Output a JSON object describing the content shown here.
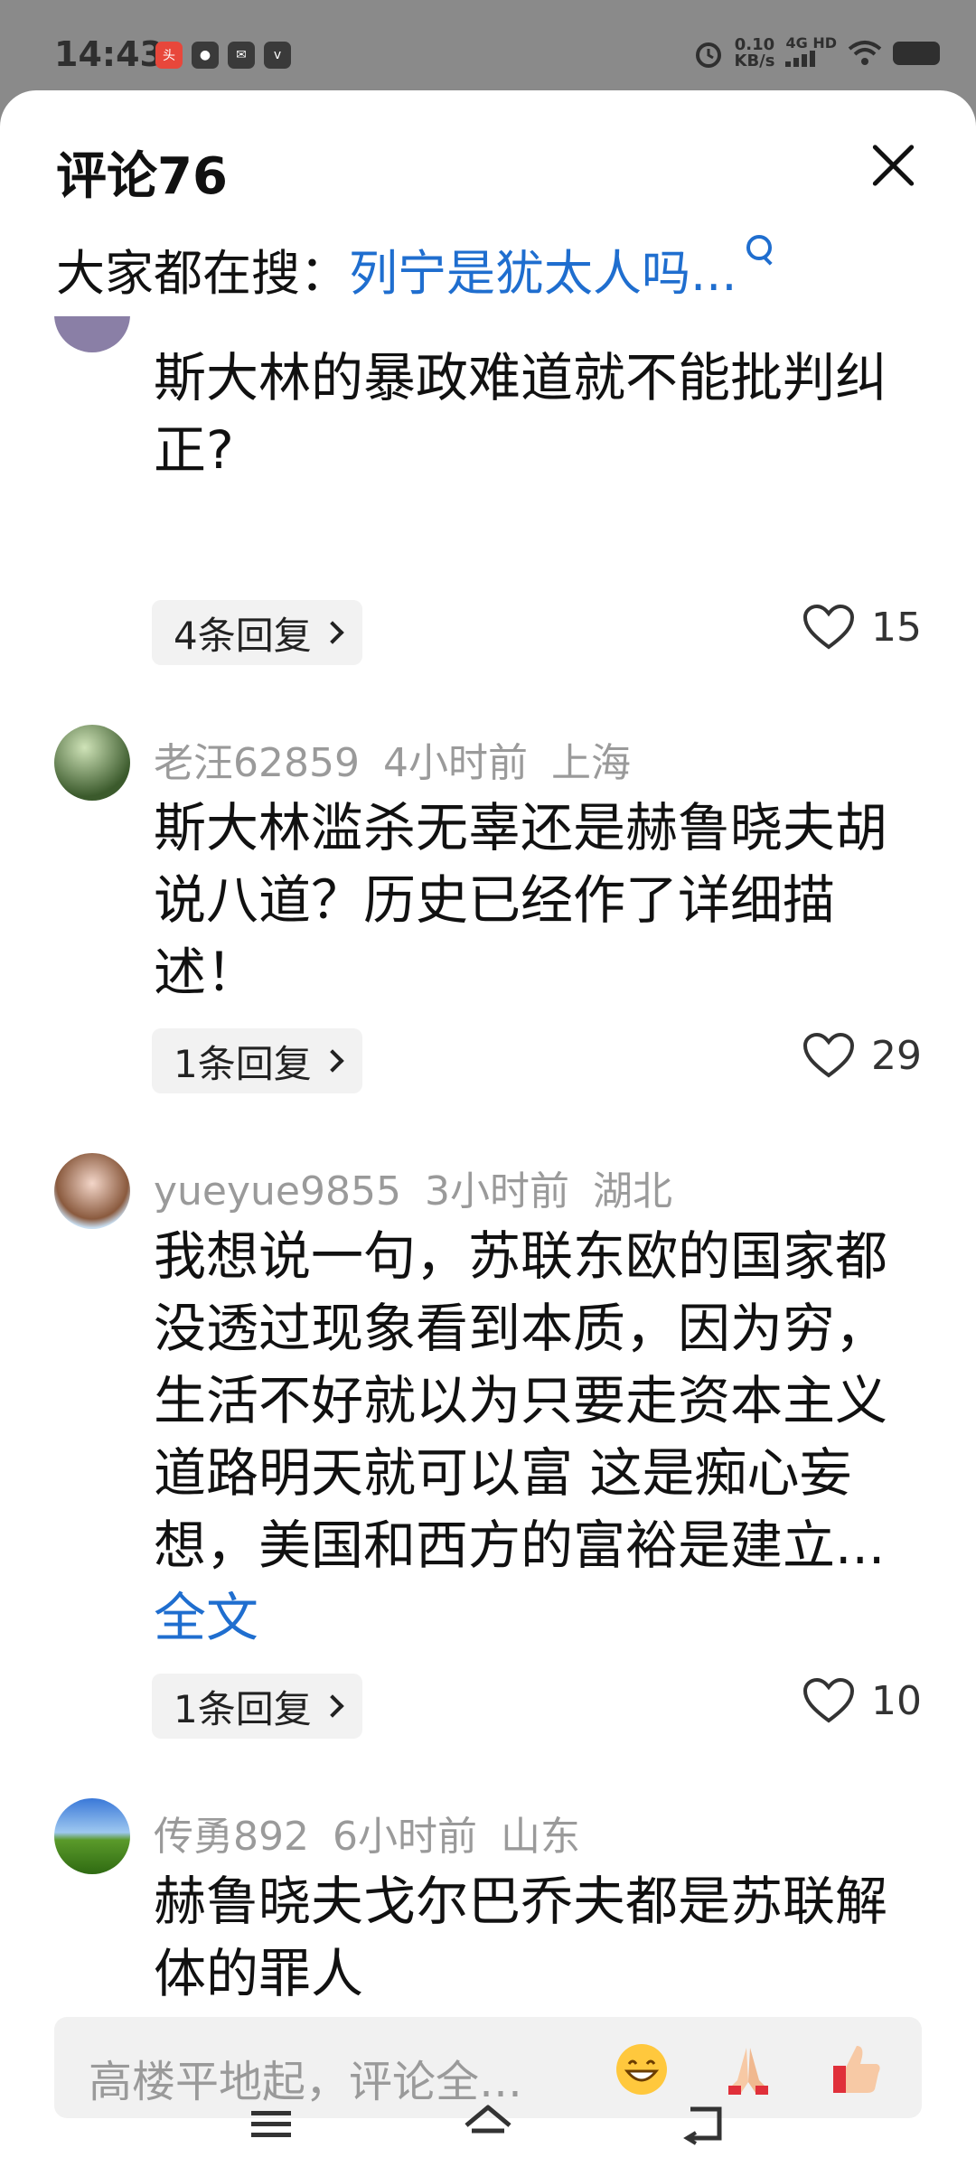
{
  "status": {
    "time": "14:43",
    "app_icons": [
      "头条",
      "wechat",
      "mail",
      "vivo"
    ],
    "net_speed_value": "0.10",
    "net_speed_unit": "KB/s",
    "net_type": "4G HD"
  },
  "sheet": {
    "title": "评论76",
    "trending_prefix": "大家都在搜：",
    "trending_link": "列宁是犹太人吗..."
  },
  "comments": [
    {
      "user": "",
      "time": "",
      "location": "",
      "text": "斯大林的暴政难道就不能批判纠正?",
      "replies": "4条回复",
      "likes": "15"
    },
    {
      "user": "老汪62859",
      "time": "4小时前",
      "location": "上海",
      "text": "斯大林滥杀无辜还是赫鲁晓夫胡说八道？历史已经作了详细描述！",
      "replies": "1条回复",
      "likes": "29"
    },
    {
      "user": "yueyue9855",
      "time": "3小时前",
      "location": "湖北",
      "text": "我想说一句，苏联东欧的国家都没透过现象看到本质，因为穷，生活不好就以为只要走资本主义道路明天就可以富 这是痴心妄想，美国和西方的富裕是建立...",
      "more": "全文",
      "replies": "1条回复",
      "likes": "10"
    },
    {
      "user": "传勇892",
      "time": "6小时前",
      "location": "山东",
      "text": "赫鲁晓夫戈尔巴乔夫都是苏联解体的罪人"
    }
  ],
  "input": {
    "placeholder": "高楼平地起，评论全…",
    "emojis": [
      "grin-emoji",
      "pray-emoji",
      "thumbs-up-emoji"
    ]
  },
  "navbar": {
    "icons": [
      "menu-icon",
      "home-icon",
      "back-icon"
    ]
  },
  "colors": {
    "link": "#1f6ecf",
    "meta": "#9a9a9a",
    "status_bg": "#8a8a8a"
  }
}
